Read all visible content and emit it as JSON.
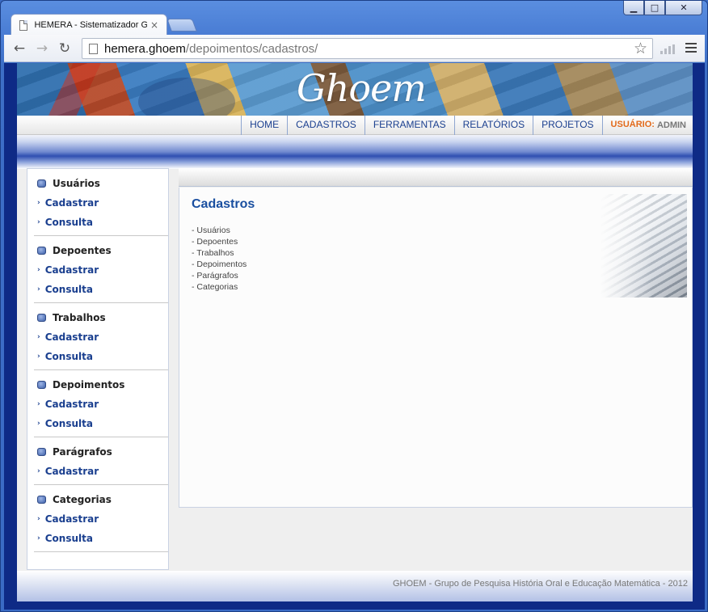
{
  "browser": {
    "tab_title": "HEMERA - Sistematizador GHOEM",
    "tab_close": "×",
    "url_host": "hemera.ghoem",
    "url_path": "/depoimentos/cadastros/"
  },
  "site": {
    "logo_text": "Ghoem",
    "nav": [
      "HOME",
      "CADASTROS",
      "FERRAMENTAS",
      "RELATÓRIOS",
      "PROJETOS"
    ],
    "user_label": "USUÁRIO:",
    "user_name": "ADMIN"
  },
  "sidebar": {
    "groups": [
      {
        "title": "Usuários",
        "links": [
          "Cadastrar",
          "Consulta"
        ]
      },
      {
        "title": "Depoentes",
        "links": [
          "Cadastrar",
          "Consulta"
        ]
      },
      {
        "title": "Trabalhos",
        "links": [
          "Cadastrar",
          "Consulta"
        ]
      },
      {
        "title": "Depoimentos",
        "links": [
          "Cadastrar",
          "Consulta"
        ]
      },
      {
        "title": "Parágrafos",
        "links": [
          "Cadastrar"
        ]
      },
      {
        "title": "Categorias",
        "links": [
          "Cadastrar",
          "Consulta"
        ]
      }
    ]
  },
  "content": {
    "title": "Cadastros",
    "items": [
      "- Usuários",
      "- Depoentes",
      "- Trabalhos",
      "- Depoimentos",
      "- Parágrafos",
      "- Categorias"
    ]
  },
  "footer": {
    "text": "GHOEM - Grupo de Pesquisa História Oral e Educação Matemática - 2012"
  }
}
